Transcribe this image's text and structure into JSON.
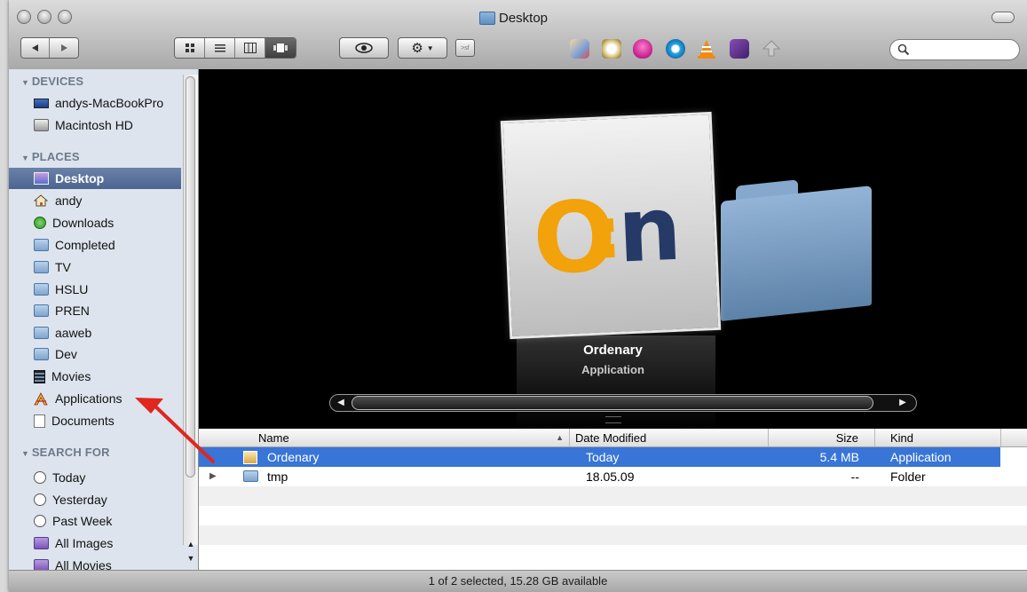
{
  "window": {
    "title": "Desktop"
  },
  "sidebar": {
    "sections": [
      {
        "key": "devices",
        "label": "DEVICES"
      },
      {
        "key": "places",
        "label": "PLACES"
      },
      {
        "key": "search_for",
        "label": "SEARCH FOR"
      }
    ],
    "devices": [
      {
        "label": "andys-MacBookPro",
        "icon": "laptop-icon"
      },
      {
        "label": "Macintosh HD",
        "icon": "hard-drive-icon"
      }
    ],
    "places": [
      {
        "label": "Desktop",
        "icon": "desktop-icon",
        "selected": true
      },
      {
        "label": "andy",
        "icon": "home-icon"
      },
      {
        "label": "Downloads",
        "icon": "downloads-icon"
      },
      {
        "label": "Completed",
        "icon": "folder-icon"
      },
      {
        "label": "TV",
        "icon": "folder-icon"
      },
      {
        "label": "HSLU",
        "icon": "folder-icon"
      },
      {
        "label": "PREN",
        "icon": "folder-icon"
      },
      {
        "label": "aaweb",
        "icon": "folder-icon"
      },
      {
        "label": "Dev",
        "icon": "folder-icon"
      },
      {
        "label": "Movies",
        "icon": "movies-icon"
      },
      {
        "label": "Applications",
        "icon": "applications-icon"
      },
      {
        "label": "Documents",
        "icon": "documents-icon"
      }
    ],
    "search_for": [
      {
        "label": "Today",
        "icon": "clock-icon"
      },
      {
        "label": "Yesterday",
        "icon": "clock-icon"
      },
      {
        "label": "Past Week",
        "icon": "clock-icon"
      },
      {
        "label": "All Images",
        "icon": "smart-folder-icon"
      },
      {
        "label": "All Movies",
        "icon": "smart-folder-icon"
      }
    ]
  },
  "coverflow": {
    "title": "Ordenary",
    "subtitle": "Application",
    "cover_logo": {
      "left": "O",
      "colon": ":",
      "right": "n"
    }
  },
  "list": {
    "columns": [
      "Name",
      "Date Modified",
      "Size",
      "Kind"
    ],
    "rows": [
      {
        "name": "Ordenary",
        "date": "Today",
        "size": "5.4 MB",
        "kind": "Application",
        "selected": true
      },
      {
        "name": "tmp",
        "date": "18.05.09",
        "size": "--",
        "kind": "Folder",
        "selected": false
      }
    ]
  },
  "status": "1 of 2 selected, 15.28 GB available",
  "colors": {
    "selection": "#3875d7",
    "sidebar_bg": "#dde4ed",
    "sidebar_selected": "#4c6591",
    "logo_orange": "#f2a20a",
    "logo_navy": "#253a66",
    "annotation_arrow": "#e0261f"
  }
}
